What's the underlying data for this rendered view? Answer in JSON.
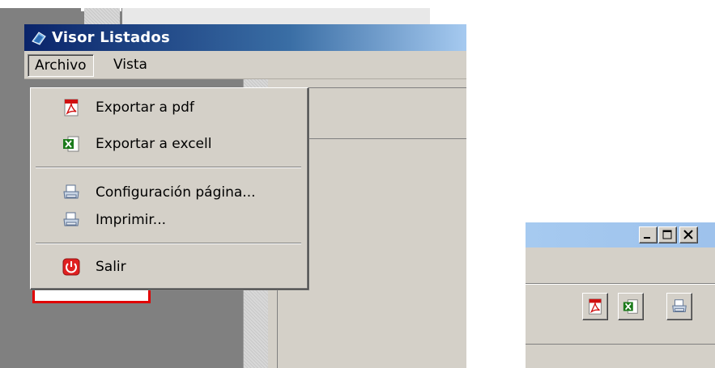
{
  "window": {
    "title": "Visor Listados"
  },
  "menubar": {
    "items": [
      {
        "label": "Archivo"
      },
      {
        "label": "Vista"
      }
    ]
  },
  "archivo_menu": {
    "items": [
      {
        "label": "Exportar a pdf",
        "icon": "pdf-icon"
      },
      {
        "label": "Exportar a excell",
        "icon": "excel-icon"
      },
      {
        "label": "Configuración página...",
        "icon": "printer-icon"
      },
      {
        "label": "Imprimir...",
        "icon": "printer-icon"
      },
      {
        "label": "Salir",
        "icon": "power-icon"
      }
    ]
  },
  "toolbar": {
    "buttons": [
      {
        "icon": "pdf-icon"
      },
      {
        "icon": "excel-icon"
      },
      {
        "icon": "printer-icon"
      }
    ]
  },
  "caption_buttons": [
    {
      "icon": "minimize-icon"
    },
    {
      "icon": "maximize-icon"
    },
    {
      "icon": "close-icon"
    }
  ],
  "colors": {
    "titlebar_active": "#0a246a",
    "titlebar_inactive": "#a6caf0",
    "window_face": "#d4d0c8",
    "pdf_red": "#d01010",
    "excel_green": "#1a7a1a"
  }
}
